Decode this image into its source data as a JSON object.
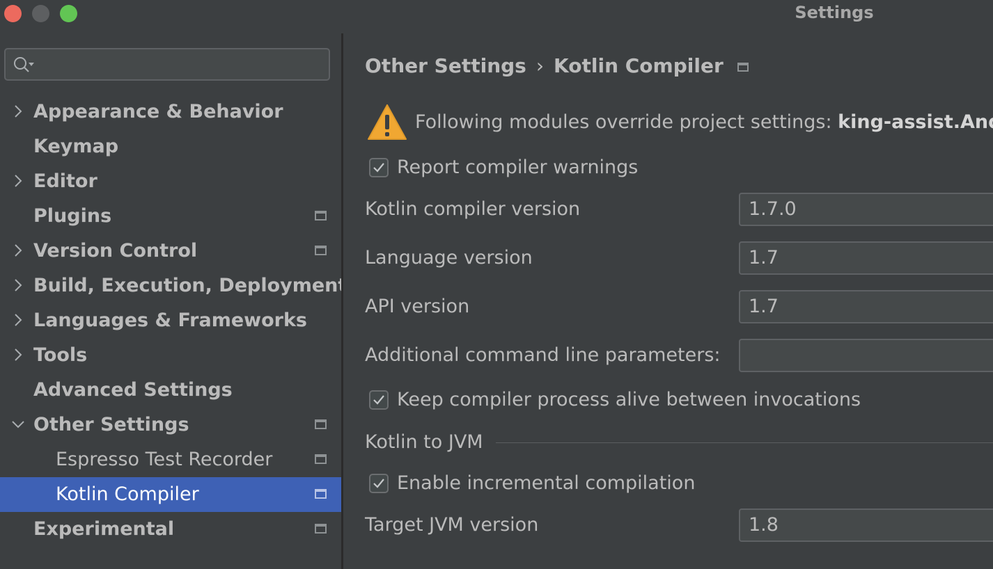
{
  "window": {
    "title": "Settings"
  },
  "search": {
    "value": "",
    "placeholder": ""
  },
  "sidebar": {
    "items": [
      {
        "label": "Appearance & Behavior",
        "expandable": true,
        "expanded": false,
        "project_level": false
      },
      {
        "label": "Keymap",
        "expandable": false,
        "project_level": false
      },
      {
        "label": "Editor",
        "expandable": true,
        "expanded": false,
        "project_level": false
      },
      {
        "label": "Plugins",
        "expandable": false,
        "project_level": true
      },
      {
        "label": "Version Control",
        "expandable": true,
        "expanded": false,
        "project_level": true
      },
      {
        "label": "Build, Execution, Deployment",
        "expandable": true,
        "expanded": false,
        "project_level": false
      },
      {
        "label": "Languages & Frameworks",
        "expandable": true,
        "expanded": false,
        "project_level": false
      },
      {
        "label": "Tools",
        "expandable": true,
        "expanded": false,
        "project_level": false
      },
      {
        "label": "Advanced Settings",
        "expandable": false,
        "project_level": false
      },
      {
        "label": "Other Settings",
        "expandable": true,
        "expanded": true,
        "project_level": true
      },
      {
        "label": "Espresso Test Recorder",
        "child": true,
        "project_level": true
      },
      {
        "label": "Kotlin Compiler",
        "child": true,
        "selected": true,
        "project_level": true
      },
      {
        "label": "Experimental",
        "expandable": false,
        "project_level": true
      }
    ]
  },
  "breadcrumb": {
    "parent": "Other Settings",
    "separator": "›",
    "current": "Kotlin Compiler"
  },
  "warning": {
    "text": "Following modules override project settings: ",
    "modules": "king-assist.And"
  },
  "options": {
    "report_warnings": {
      "label": "Report compiler warnings",
      "checked": true
    },
    "compiler_version": {
      "label": "Kotlin compiler version",
      "value": "1.7.0"
    },
    "language_version": {
      "label": "Language version",
      "value": "1.7"
    },
    "api_version": {
      "label": "API version",
      "value": "1.7"
    },
    "additional_params": {
      "label": "Additional command line parameters:",
      "value": ""
    },
    "keep_alive": {
      "label": "Keep compiler process alive between invocations",
      "checked": true
    }
  },
  "jvm_section": {
    "title": "Kotlin to JVM",
    "incremental": {
      "label": "Enable incremental compilation",
      "checked": true
    },
    "target_jvm": {
      "label": "Target JVM version",
      "value": "1.8"
    }
  },
  "colors": {
    "background": "#3c3f41",
    "selection": "#3e61b5",
    "text": "#bbbbbb",
    "warning_yellow": "#f0a732",
    "close_button": "#ec6a5e",
    "maximize_button": "#62c554"
  }
}
